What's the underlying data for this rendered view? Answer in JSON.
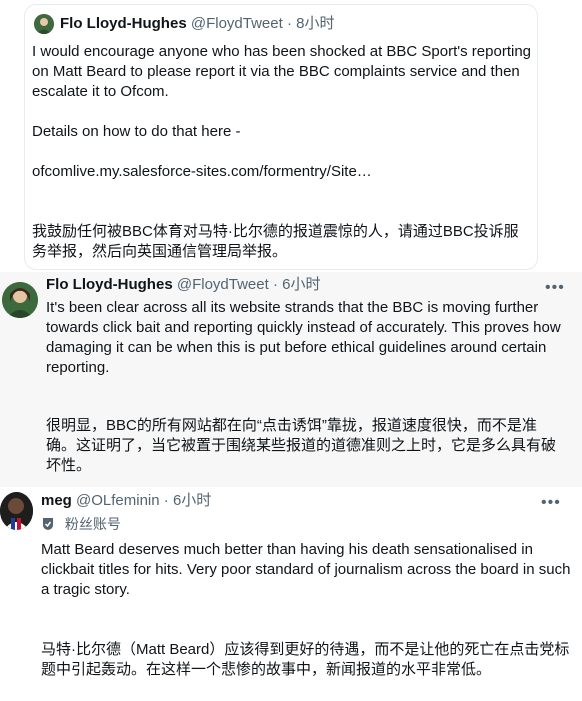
{
  "quoted_tweet": {
    "name": "Flo Lloyd-Hughes",
    "handle": "@FloydTweet",
    "time": "8小时",
    "text": "I would encourage anyone who has been shocked at BBC Sport's reporting on Matt Beard to please report it via the BBC complaints service and then escalate it to Ofcom.\n\nDetails on how to do that here -\n\nofcomlive.my.salesforce-sites.com/formentry/Site…",
    "translation": "我鼓励任何被BBC体育对马特·比尔德的报道震惊的人，请通过BBC投诉服务举报，然后向英国通信管理局举报。"
  },
  "reply_tweet": {
    "name": "Flo Lloyd-Hughes",
    "handle": "@FloydTweet",
    "time": "6小时",
    "text": "It's been clear across all its website strands that the BBC is moving further towards click bait and reporting quickly instead of accurately. This proves how damaging it can be when this is put before ethical guidelines around certain reporting.",
    "translation": "很明显，BBC的所有网站都在向“点击诱饵”靠拢，报道速度很快，而不是准确。这证明了，当它被置于围绕某些报道的道德准则之上时，它是多么具有破坏性。"
  },
  "third_tweet": {
    "name": "meg",
    "handle": "@OLfeminin",
    "time": "6小时",
    "badge": "粉丝账号",
    "text": "Matt Beard deserves much better than having his death sensationalised in clickbait titles for hits. Very poor standard of journalism across the board in such a tragic story.",
    "translation": "马特·比尔德（Matt Beard）应该得到更好的待遇，而不是让他的死亡在点击党标题中引起轰动。在这样一个悲惨的故事中，新闻报道的水平非常低。"
  },
  "separator": "·",
  "more_glyph": "•••"
}
